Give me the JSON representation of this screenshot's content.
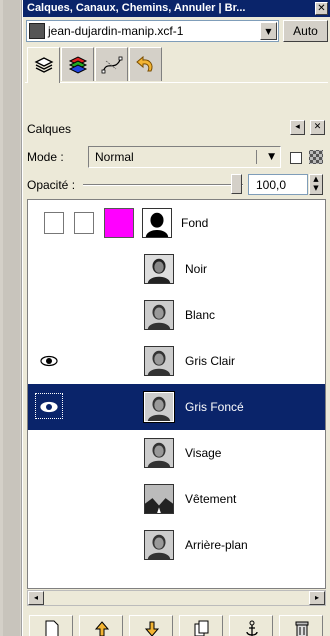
{
  "window": {
    "title": "Calques, Canaux, Chemins, Annuler | Br..."
  },
  "image_selector": {
    "value": "jean-dujardin-manip.xcf-1",
    "auto_label": "Auto"
  },
  "tabs": [
    {
      "icon": "layers-icon"
    },
    {
      "icon": "channels-icon"
    },
    {
      "icon": "paths-icon"
    },
    {
      "icon": "undo-icon"
    }
  ],
  "dock": {
    "title": "Calques"
  },
  "mode": {
    "label": "Mode :",
    "value": "Normal"
  },
  "opacity": {
    "label": "Opacité :",
    "value": "100,0",
    "level": 100
  },
  "layers": [
    {
      "name": "Fond",
      "visible": false,
      "selected": false
    },
    {
      "name": "Noir",
      "visible": false,
      "selected": false
    },
    {
      "name": "Blanc",
      "visible": false,
      "selected": false
    },
    {
      "name": "Gris Clair",
      "visible": true,
      "selected": false
    },
    {
      "name": "Gris Foncé",
      "visible": true,
      "selected": true
    },
    {
      "name": "Visage",
      "visible": false,
      "selected": false
    },
    {
      "name": "Vêtement",
      "visible": false,
      "selected": false
    },
    {
      "name": "Arrière-plan",
      "visible": false,
      "selected": false
    }
  ],
  "bottom_toolbar": [
    {
      "icon": "new-layer-icon"
    },
    {
      "icon": "raise-layer-icon"
    },
    {
      "icon": "lower-layer-icon"
    },
    {
      "icon": "duplicate-layer-icon"
    },
    {
      "icon": "anchor-layer-icon"
    },
    {
      "icon": "delete-layer-icon"
    }
  ],
  "colors": {
    "selection": "#0a246a",
    "titlebar": "#0a246a",
    "fond_thumb": "#ff00ff"
  }
}
